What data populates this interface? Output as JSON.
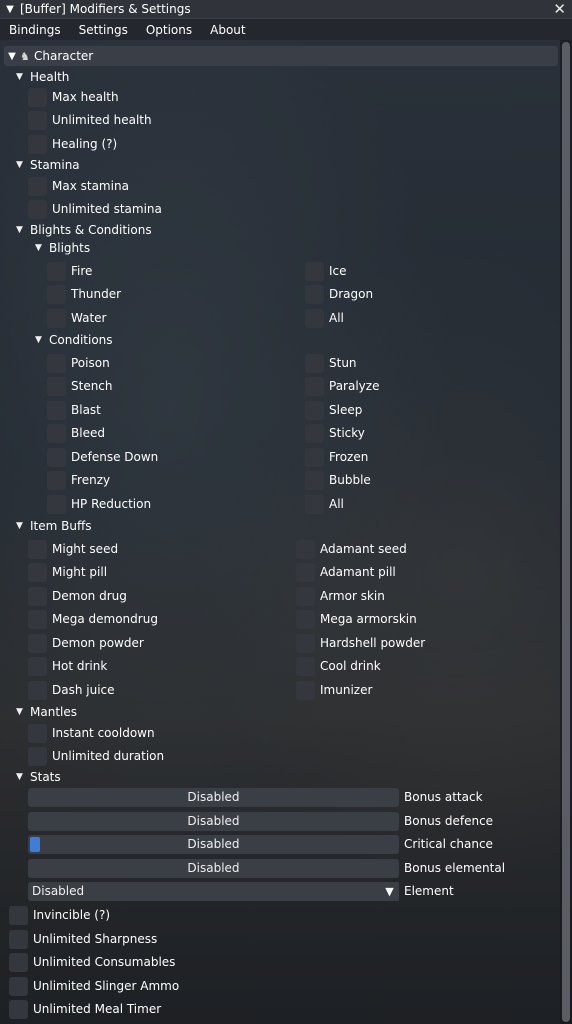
{
  "window": {
    "title": "[Buffer] Modifiers & Settings",
    "close_glyph": "✕"
  },
  "menu": [
    "Bindings",
    "Settings",
    "Options",
    "About"
  ],
  "character_header": "Character",
  "health": {
    "label": "Health",
    "items": [
      "Max health",
      "Unlimited health",
      "Healing  (?)"
    ]
  },
  "stamina": {
    "label": "Stamina",
    "items": [
      "Max stamina",
      "Unlimited stamina"
    ]
  },
  "blights_conditions": {
    "label": "Blights & Conditions",
    "blights": {
      "label": "Blights",
      "left": [
        "Fire",
        "Thunder",
        "Water"
      ],
      "right": [
        "Ice",
        "Dragon",
        "All"
      ]
    },
    "conditions": {
      "label": "Conditions",
      "left": [
        "Poison",
        "Stench",
        "Blast",
        "Bleed",
        "Defense Down",
        "Frenzy",
        "HP Reduction"
      ],
      "right": [
        "Stun",
        "Paralyze",
        "Sleep",
        "Sticky",
        "Frozen",
        "Bubble",
        "All"
      ]
    }
  },
  "item_buffs": {
    "label": "Item Buffs",
    "left": [
      "Might seed",
      "Might pill",
      "Demon drug",
      "Mega demondrug",
      "Demon powder",
      "Hot drink",
      "Dash juice"
    ],
    "right": [
      "Adamant seed",
      "Adamant pill",
      "Armor skin",
      "Mega armorskin",
      "Hardshell powder",
      "Cool drink",
      "Imunizer"
    ]
  },
  "mantles": {
    "label": "Mantles",
    "items": [
      "Instant cooldown",
      "Unlimited duration"
    ]
  },
  "stats": {
    "label": "Stats",
    "sliders": [
      {
        "value": "Disabled",
        "label": "Bonus attack"
      },
      {
        "value": "Disabled",
        "label": "Bonus defence"
      },
      {
        "value": "Disabled",
        "label": "Critical chance"
      },
      {
        "value": "Disabled",
        "label": "Bonus elemental"
      }
    ],
    "element": {
      "value": "Disabled",
      "label": "Element"
    }
  },
  "toggles": [
    "Invincible  (?)",
    "Unlimited Sharpness",
    "Unlimited Consumables",
    "Unlimited Slinger Ammo",
    "Unlimited Meal Timer"
  ],
  "colors": {
    "accent": "#3d7fd8",
    "frame": "#3a3e45"
  }
}
